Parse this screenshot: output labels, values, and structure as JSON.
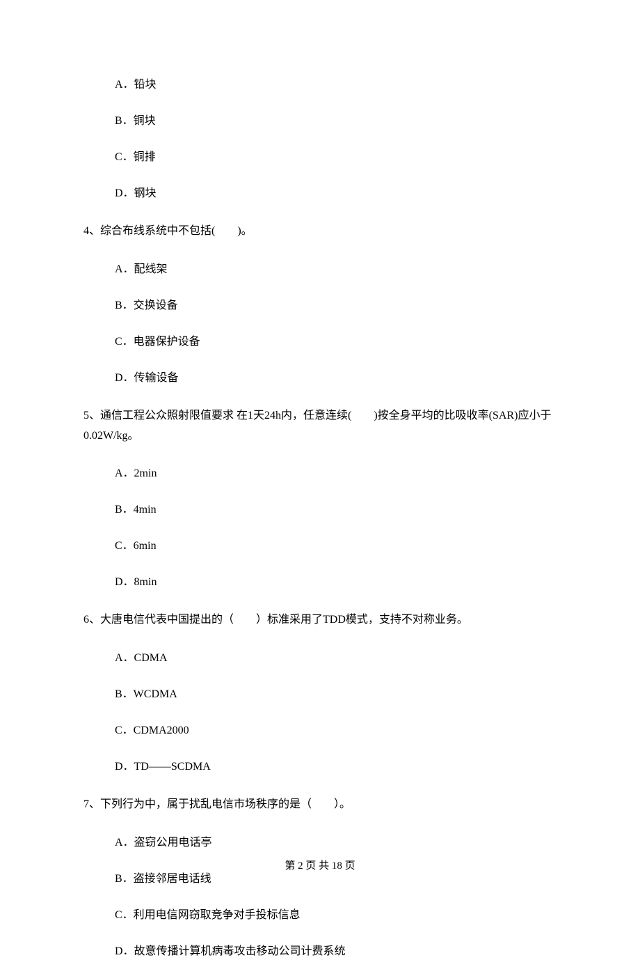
{
  "q3_options": {
    "a": "A．铅块",
    "b": "B．铜块",
    "c": "C．铜排",
    "d": "D．钢块"
  },
  "q4": {
    "text": "4、综合布线系统中不包括(　　)。",
    "options": {
      "a": "A．配线架",
      "b": "B．交换设备",
      "c": "C．电器保护设备",
      "d": "D．传输设备"
    }
  },
  "q5": {
    "text": "5、通信工程公众照射限值要求 在1天24h内，任意连续(　　)按全身平均的比吸收率(SAR)应小于0.02W/kg。",
    "options": {
      "a": "A．2min",
      "b": "B．4min",
      "c": "C．6min",
      "d": "D．8min"
    }
  },
  "q6": {
    "text": "6、大唐电信代表中国提出的（　　）标准采用了TDD模式，支持不对称业务。",
    "options": {
      "a": "A．CDMA",
      "b": "B．WCDMA",
      "c": "C．CDMA2000",
      "d": "D．TD——SCDMA"
    }
  },
  "q7": {
    "text": "7、下列行为中，属于扰乱电信市场秩序的是（　　）。",
    "options": {
      "a": "A．盗窃公用电话亭",
      "b": "B．盗接邻居电话线",
      "c": "C．利用电信网窃取竞争对手投标信息",
      "d": "D．故意传播计算机病毒攻击移动公司计费系统"
    }
  },
  "footer": "第 2 页 共 18 页"
}
